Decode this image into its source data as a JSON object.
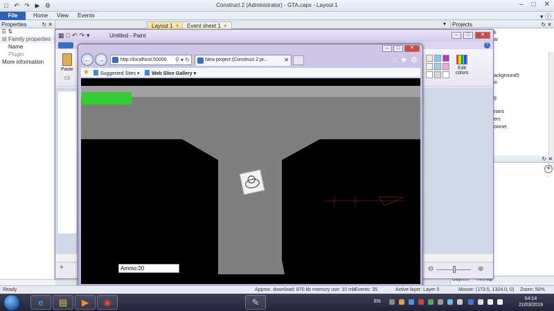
{
  "construct": {
    "window_title": "Construct 2 (Administrator) - GTA.capx - Layout 1",
    "ribbon_tabs": [
      "File",
      "Home",
      "View",
      "Events"
    ],
    "properties_panel": {
      "title": "Properties",
      "sort_icons": "☰ ⇅",
      "category": "Family properties",
      "rows": [
        "Name",
        "Plugin"
      ],
      "link": "More information"
    },
    "doc_tabs": [
      {
        "label": "Layout 1",
        "close": "×"
      },
      {
        "label": "Event sheet 1",
        "close": "×"
      }
    ],
    "projects_panel": {
      "title": "Projects",
      "items": [
        "k",
        "ar",
        "ackground5",
        "in",
        "g",
        "rians",
        "ers",
        "owner"
      ]
    },
    "objects_tabs": [
      "Objects",
      "Tilemap"
    ],
    "status_bar": {
      "ready": "Ready",
      "download": "Approx. download: 870 kb",
      "memory": "memory use: 10 mb",
      "events": "Events: 35",
      "active_layer": "Active layer: Layer 0",
      "mouse": "Mouse: (173.5, 1324.0, 0)",
      "zoom": "Zoom: 50%"
    }
  },
  "paint": {
    "title": "Untitled - Paint",
    "paste_label": "Paste",
    "clipboard_label": "Cli",
    "edit_colors_label": "Edit colors",
    "palette": [
      "#e8e8e8",
      "#7fc8f0",
      "#b83cb8",
      "#f0f0f0",
      "#9fd0ea",
      "#f0a8d8",
      "#ffffff",
      "#d8d8d8",
      "#ffffff"
    ],
    "help": "?"
  },
  "browser": {
    "address": "http://localhost:50000",
    "tab_title": "New project (Construct 2 pr...",
    "favorites": [
      {
        "label": "Suggested Sites ▾"
      },
      {
        "label": "Web Slice Gallery ▾"
      }
    ]
  },
  "game": {
    "ammo_label": "Ammo:20",
    "health_color": "#33cc33"
  },
  "taskbar": {
    "lang": "EN",
    "time": "04:14",
    "date": "21/03/2019"
  }
}
